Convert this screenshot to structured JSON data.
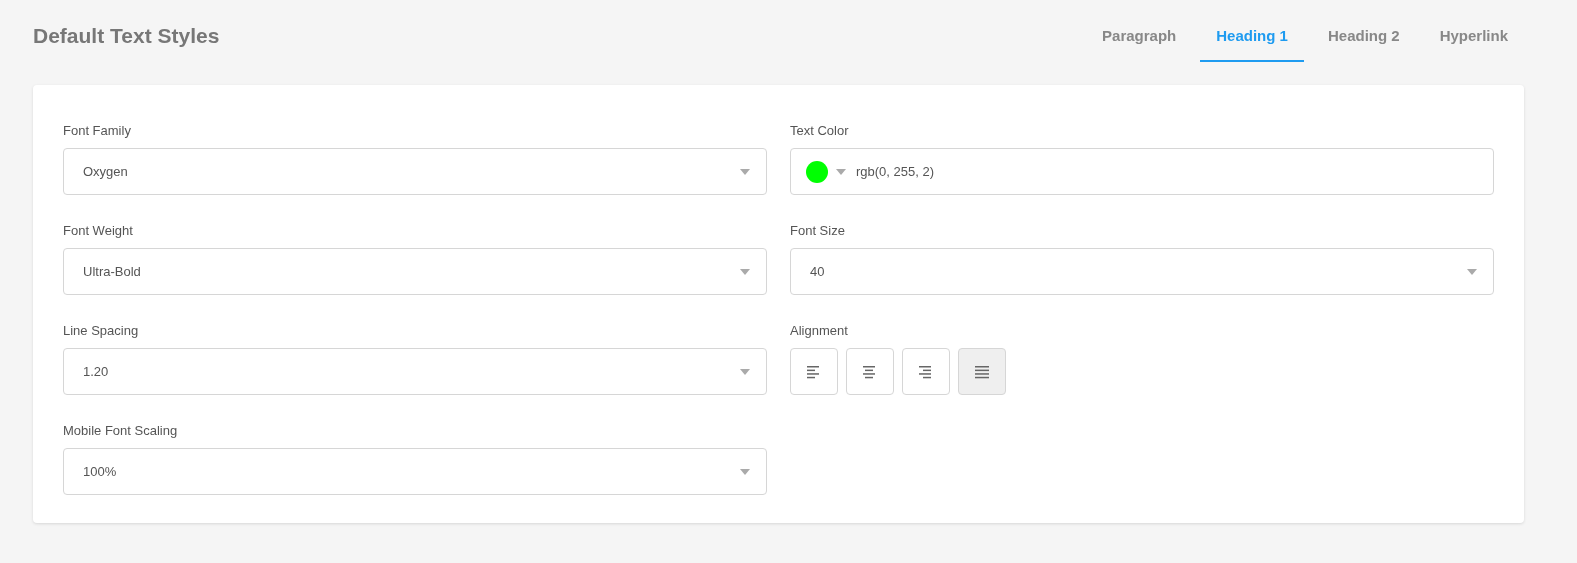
{
  "title": "Default Text Styles",
  "tabs": [
    {
      "label": "Paragraph",
      "selected": false
    },
    {
      "label": "Heading 1",
      "selected": true
    },
    {
      "label": "Heading 2",
      "selected": false
    },
    {
      "label": "Hyperlink",
      "selected": false
    }
  ],
  "fields": [
    {
      "kind": "select",
      "label": "Font Family",
      "value": "Oxygen"
    },
    {
      "kind": "color",
      "label": "Text Color",
      "value": "rgb(0, 255, 2)",
      "color": "#00ff02"
    },
    {
      "kind": "select",
      "label": "Font Weight",
      "value": "Ultra-Bold"
    },
    {
      "kind": "select",
      "label": "Font Size",
      "value": "40"
    },
    {
      "kind": "select",
      "label": "Line Spacing",
      "value": "1.20"
    },
    {
      "kind": "alignment",
      "label": "Alignment",
      "options": [
        {
          "kind": "left",
          "selected": false
        },
        {
          "kind": "center",
          "selected": false
        },
        {
          "kind": "right",
          "selected": false
        },
        {
          "kind": "justify",
          "selected": true
        }
      ]
    },
    {
      "kind": "select",
      "label": "Mobile Font Scaling",
      "value": "100%"
    }
  ]
}
